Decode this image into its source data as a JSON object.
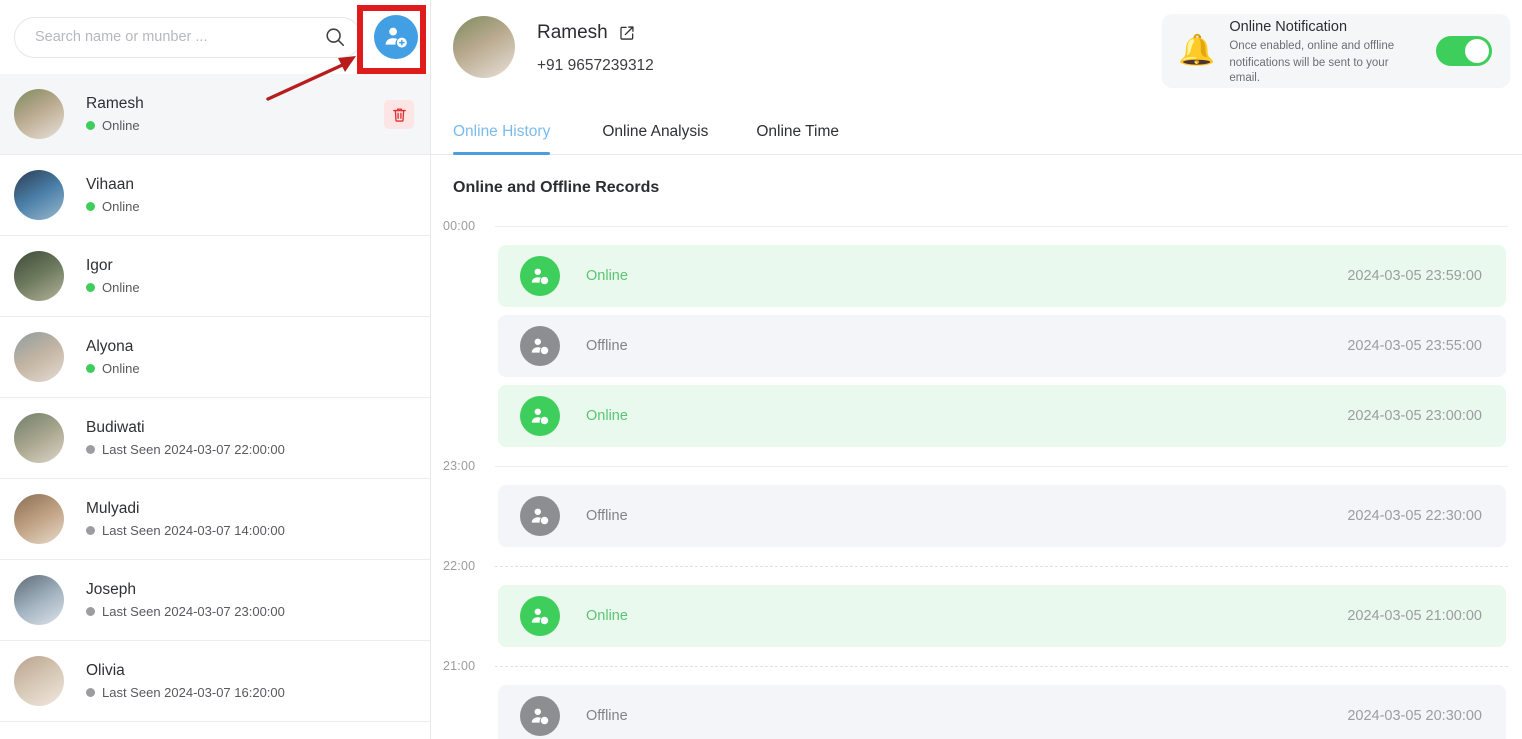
{
  "sidebar": {
    "search": {
      "placeholder": "Search name or munber ...",
      "value": "",
      "icon": "search-icon"
    },
    "add_contact_button": {
      "icon": "add-user-icon",
      "color": "#429fe3"
    },
    "contacts": [
      {
        "name": "Ramesh",
        "status": "Online",
        "state": "online",
        "selected": true,
        "has_delete": true
      },
      {
        "name": "Vihaan",
        "status": "Online",
        "state": "online",
        "selected": false,
        "has_delete": false
      },
      {
        "name": "Igor",
        "status": "Online",
        "state": "online",
        "selected": false,
        "has_delete": false
      },
      {
        "name": "Alyona",
        "status": "Online",
        "state": "online",
        "selected": false,
        "has_delete": false
      },
      {
        "name": "Budiwati",
        "status": "Last Seen 2024-03-07 22:00:00",
        "state": "offline",
        "selected": false,
        "has_delete": false
      },
      {
        "name": "Mulyadi",
        "status": "Last Seen 2024-03-07 14:00:00",
        "state": "offline",
        "selected": false,
        "has_delete": false
      },
      {
        "name": "Joseph",
        "status": "Last Seen 2024-03-07 23:00:00",
        "state": "offline",
        "selected": false,
        "has_delete": false
      },
      {
        "name": "Olivia",
        "status": "Last Seen 2024-03-07 16:20:00",
        "state": "offline",
        "selected": false,
        "has_delete": false
      }
    ]
  },
  "profile": {
    "name": "Ramesh",
    "phone": "+91 9657239312",
    "edit_icon": "edit-icon"
  },
  "tabs": [
    {
      "label": "Online History",
      "active": true
    },
    {
      "label": "Online Analysis",
      "active": false
    },
    {
      "label": "Online Time",
      "active": false
    }
  ],
  "notification": {
    "icon": "bell-icon",
    "title": "Online Notification",
    "subtitle_line1": "Once enabled, online and offline",
    "subtitle_line2": "notifications will be sent to your email.",
    "toggle_state": "on",
    "toggle_color": "#3ece5b"
  },
  "records": {
    "title": "Online and Offline Records",
    "groups": [
      {
        "time_label": "00:00",
        "line_style": "solid",
        "entries": [
          {
            "status": "Online",
            "state": "online",
            "timestamp": "2024-03-05 23:59:00"
          },
          {
            "status": "Offline",
            "state": "offline",
            "timestamp": "2024-03-05 23:55:00"
          },
          {
            "status": "Online",
            "state": "online",
            "timestamp": "2024-03-05 23:00:00"
          }
        ]
      },
      {
        "time_label": "23:00",
        "line_style": "solid",
        "entries": [
          {
            "status": "Offline",
            "state": "offline",
            "timestamp": "2024-03-05 22:30:00"
          }
        ]
      },
      {
        "time_label": "22:00",
        "line_style": "dashed",
        "entries": [
          {
            "status": "Online",
            "state": "online",
            "timestamp": "2024-03-05 21:00:00"
          }
        ]
      },
      {
        "time_label": "21:00",
        "line_style": "dashed",
        "entries": [
          {
            "status": "Offline",
            "state": "offline",
            "timestamp": "2024-03-05 20:30:00"
          }
        ]
      }
    ]
  },
  "annotations": {
    "highlight_color": "#e01b1b",
    "highlight_target": "add-contact-button",
    "arrow": "points-to-add-contact-button"
  }
}
